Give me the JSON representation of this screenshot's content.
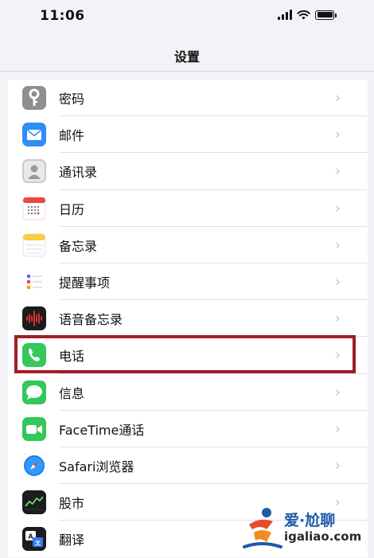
{
  "status_bar": {
    "time": "11:06"
  },
  "nav": {
    "title": "设置"
  },
  "settings_items": [
    {
      "label": "密码",
      "icon": "key-icon",
      "color": "#8e8e93"
    },
    {
      "label": "邮件",
      "icon": "mail-icon",
      "color": "#2f8ef4"
    },
    {
      "label": "通讯录",
      "icon": "contacts-icon",
      "color": "#c9c9cc"
    },
    {
      "label": "日历",
      "icon": "calendar-icon",
      "color": "#ffffff"
    },
    {
      "label": "备忘录",
      "icon": "notes-icon",
      "color": "#ffffff"
    },
    {
      "label": "提醒事项",
      "icon": "reminders-icon",
      "color": "#ffffff"
    },
    {
      "label": "语音备忘录",
      "icon": "voice-memos-icon",
      "color": "#1c1c1e"
    },
    {
      "label": "电话",
      "icon": "phone-icon",
      "color": "#34c759",
      "highlighted": true
    },
    {
      "label": "信息",
      "icon": "messages-icon",
      "color": "#34c759"
    },
    {
      "label": "FaceTime通话",
      "icon": "facetime-icon",
      "color": "#34c759"
    },
    {
      "label": "Safari浏览器",
      "icon": "safari-icon",
      "color": "#1e7cf0"
    },
    {
      "label": "股市",
      "icon": "stocks-icon",
      "color": "#1c1c1e"
    },
    {
      "label": "翻译",
      "icon": "translate-icon",
      "color": "#1c1c1e"
    }
  ],
  "highlight_color": "#a01e23",
  "watermark": {
    "top": "爱·尬聊",
    "bottom": "igaliao.com"
  }
}
